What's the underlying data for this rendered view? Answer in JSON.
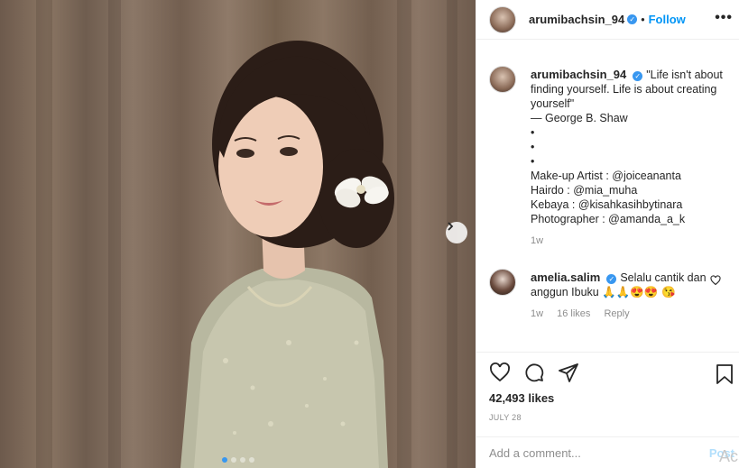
{
  "post": {
    "username": "arumibachsin_94",
    "follow_label": "Follow",
    "separator": "•",
    "more_label": "•••"
  },
  "caption": {
    "username": "arumibachsin_94",
    "lines": [
      "\"Life isn't about finding yourself. Life is about creating yourself\"",
      "— George B. Shaw",
      "•",
      "•",
      "•",
      "Make-up Artist : @joiceananta",
      "Hairdo : @mia_muha",
      "Kebaya : @kisahkasihbytinara",
      "Photographer : @amanda_a_k"
    ],
    "time": "1w"
  },
  "comment": {
    "username": "amelia.salim",
    "text": "Selalu cantik dan anggun Ibuku 🙏🙏😍😍 😘",
    "time": "1w",
    "likes": "16 likes",
    "reply_label": "Reply"
  },
  "stats": {
    "likes": "42,493 likes",
    "date": "JULY 28"
  },
  "add_comment": {
    "placeholder": "Add a comment...",
    "post_label": "Post"
  },
  "watermark": "Ac",
  "carousel": {
    "slides": 4,
    "active_index": 0
  },
  "colors": {
    "accent": "#0095f6",
    "verified": "#3897f0",
    "muted": "#8e8e8e"
  }
}
